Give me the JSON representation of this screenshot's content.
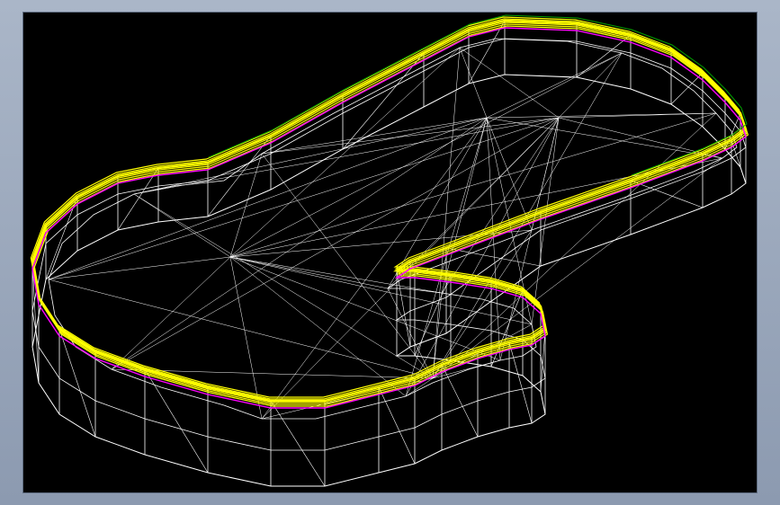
{
  "view": {
    "kind": "cad-wireframe",
    "background_color": "#000000",
    "frame_color": "#9aa7bb"
  },
  "colors": {
    "outline": "#ffff00",
    "accent_1": "#ff00ff",
    "accent_2": "#00a000",
    "mesh": "#ffffff"
  }
}
